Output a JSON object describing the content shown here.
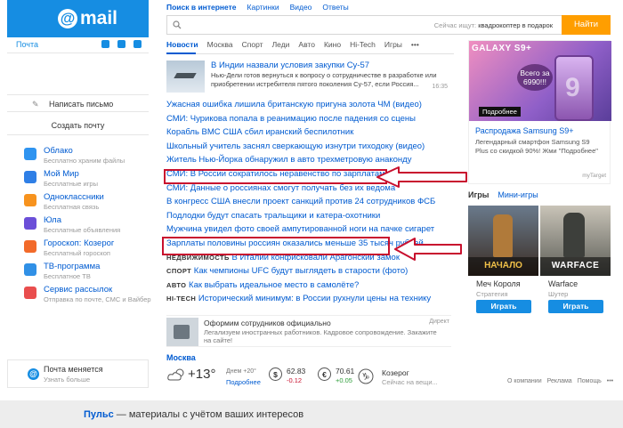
{
  "logo": {
    "text": "mail"
  },
  "mail_row": {
    "label": "Почта"
  },
  "left": {
    "write_label": "Написать письмо",
    "create_label": "Создать почту",
    "services": [
      {
        "name": "Облако",
        "desc": "Бесплатно храним файлы",
        "color": "#2f94f0"
      },
      {
        "name": "Мой Мир",
        "desc": "Бесплатные игры",
        "color": "#2f7fe6"
      },
      {
        "name": "Одноклассники",
        "desc": "Бесплатная связь",
        "color": "#f7931e"
      },
      {
        "name": "Юла",
        "desc": "Бесплатные объявления",
        "color": "#6b4fd8"
      },
      {
        "name": "Гороскоп: Козерог",
        "desc": "Бесплатный гороскоп",
        "color": "#f26a2a"
      },
      {
        "name": "ТВ-программа",
        "desc": "Бесплатное ТВ",
        "color": "#3090e6"
      },
      {
        "name": "Сервис рассылок",
        "desc": "Отправка по почте, СМС и Вайбер",
        "color": "#e94e4e"
      }
    ],
    "moved_title": "Почта меняется",
    "moved_more": "Узнать больше"
  },
  "search": {
    "tabs": [
      "Поиск в интернете",
      "Картинки",
      "Видео",
      "Ответы"
    ],
    "hint_prefix": "Сейчас ищут:",
    "hint_query": "квадрокоптер в подарок",
    "button": "Найти"
  },
  "news_tabs": [
    "Новости",
    "Москва",
    "Спорт",
    "Леди",
    "Авто",
    "Кино",
    "Hi-Tech",
    "Игры",
    "•••"
  ],
  "top_story": {
    "headline": "В Индии назвали условия закупки Су-57",
    "text": "Нью-Дели готов вернуться к вопросу о сотрудничестве в разработке или приобретении истребителя пятого поколения Су-57, если Россия...",
    "time": "16:35"
  },
  "news": [
    {
      "rubric": "",
      "text": "Ужасная ошибка лишила британскую пригуна золота ЧМ (видео)"
    },
    {
      "rubric": "",
      "text": "СМИ: Чурикова попала в реанимацию после падения со сцены"
    },
    {
      "rubric": "",
      "text": "Корабль ВМС США сбил иранский беспилотник"
    },
    {
      "rubric": "",
      "text": "Школьный учитель заснял сверкающую изнутри тиходоку (видео)"
    },
    {
      "rubric": "",
      "text": "Житель Нью-Йорка обнаружил в авто трехметровую анаконду"
    },
    {
      "rubric": "",
      "text": "СМИ: В России сократилось неравенство по зарплатам"
    },
    {
      "rubric": "",
      "text": "СМИ: Данные о россиянах смогут получать без их ведома"
    },
    {
      "rubric": "",
      "text": "В конгресс США внесли проект санкций против 24 сотрудников ФСБ"
    },
    {
      "rubric": "",
      "text": "Подлодки будут спасать тральщики и катера-охотники"
    },
    {
      "rubric": "",
      "text": "Мужчина увидел фото своей ампутированной ноги на пачке сигарет"
    },
    {
      "rubric": "",
      "text": "Зарплаты половины россиян оказались меньше 35 тысяч рублей"
    },
    {
      "rubric": "НЕДВИЖИМОСТЬ",
      "text": "В Италии конфисковали Арагонский замок"
    },
    {
      "rubric": "СПОРТ",
      "text": "Как чемпионы UFC будут выглядеть в старости (фото)"
    },
    {
      "rubric": "АВТО",
      "text": "Как выбрать идеальное место в самолёте?"
    },
    {
      "rubric": "HI-TECH",
      "text": "Исторический минимум: в России рухнули цены на технику"
    }
  ],
  "ad_bottom": {
    "title": "Оформим сотрудников официально",
    "text": "Легализуем иностранных работников. Кадровое сопровождение. Закажите на сайте!",
    "marker": "Директ"
  },
  "weather": {
    "city": "Москва",
    "temp": "+13°",
    "day": "Днем +20°",
    "more": "Подробнее"
  },
  "rates": [
    {
      "sym": "$",
      "value": "62.83",
      "delta": "-0.12",
      "color": "#c8102e"
    },
    {
      "sym": "€",
      "value": "70.61",
      "delta": "+0.05",
      "color": "#2e9d3a"
    }
  ],
  "horoscope": {
    "name": "Козерог",
    "sub": "Сейчас на вещи..."
  },
  "right_ad": {
    "brand": "GALAXY S9+",
    "price": "Всего за 6990!!!",
    "more": "Подробнее",
    "title": "Распродажа Samsung S9+",
    "text": "Легендарный смартфон Samsung S9 Plus со скидкой 90%! Жми \"Подробнее\"",
    "marker": "myTarget"
  },
  "games_tabs": [
    "Игры",
    "Мини-игры"
  ],
  "games": [
    {
      "name": "Меч Короля",
      "genre": "Стратегия",
      "play": "Играть",
      "art": "НАЧАЛО"
    },
    {
      "name": "Warface",
      "genre": "Шутер",
      "play": "Играть",
      "art": "WARFACE"
    }
  ],
  "footer_links": [
    "О компании",
    "Реклама",
    "Помощь",
    "•••"
  ],
  "pulse": {
    "brand": "Пульс",
    "text": " — материалы с учётом ваших интересов"
  }
}
